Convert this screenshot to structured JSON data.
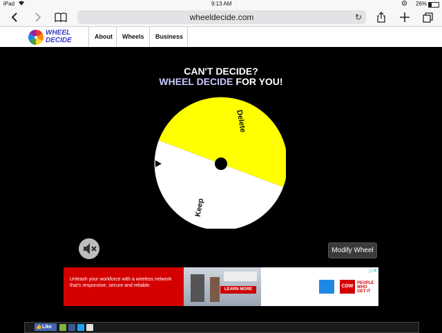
{
  "status_bar": {
    "device": "iPad",
    "time": "9:13 AM",
    "battery": "26%",
    "battery_level": 0.26
  },
  "browser": {
    "url": "wheeldecide.com"
  },
  "site_nav": {
    "logo_line1": "WHEEL",
    "logo_line2": "DECIDE",
    "links": [
      {
        "label": "About"
      },
      {
        "label": "Wheels"
      },
      {
        "label": "Business"
      }
    ]
  },
  "headline": {
    "line1": "CAN'T DECIDE?",
    "line2_accent": "WHEEL DECIDE",
    "line2_rest": " FOR YOU!"
  },
  "wheel": {
    "segments": [
      {
        "label": "Delete",
        "color": "#ffff00"
      },
      {
        "label": "Keep",
        "color": "#ffffff"
      }
    ]
  },
  "controls": {
    "modify_label": "Modify Wheel"
  },
  "ad": {
    "text": "Unleash your workforce with a wireless network that's responsive, secure and reliable.",
    "cta": "LEARN MORE",
    "brand": "CDW",
    "tagline": [
      "PEOPLE",
      "WHO",
      "GET IT"
    ]
  },
  "share": {
    "like": "Like"
  },
  "colors": {
    "accent": "#c9c9ff",
    "wheel_yellow": "#ffff00",
    "ad_red": "#d40000"
  }
}
